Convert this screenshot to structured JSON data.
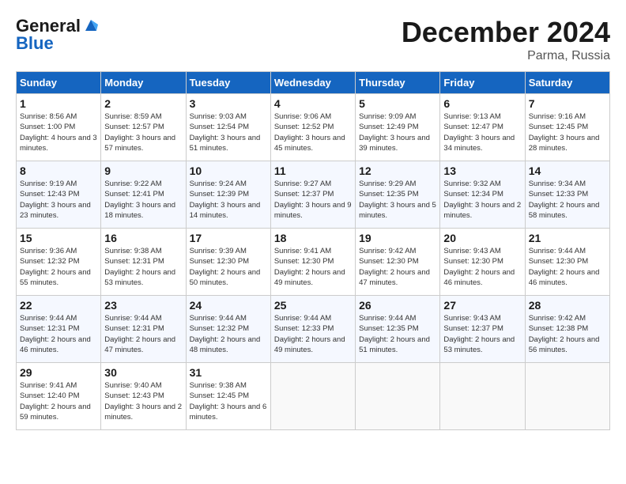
{
  "header": {
    "logo_general": "General",
    "logo_blue": "Blue",
    "title": "December 2024",
    "location": "Parma, Russia"
  },
  "days_of_week": [
    "Sunday",
    "Monday",
    "Tuesday",
    "Wednesday",
    "Thursday",
    "Friday",
    "Saturday"
  ],
  "weeks": [
    [
      {
        "day": "1",
        "sunrise": "Sunrise: 8:56 AM",
        "sunset": "Sunset: 1:00 PM",
        "daylight": "Daylight: 4 hours and 3 minutes."
      },
      {
        "day": "2",
        "sunrise": "Sunrise: 8:59 AM",
        "sunset": "Sunset: 12:57 PM",
        "daylight": "Daylight: 3 hours and 57 minutes."
      },
      {
        "day": "3",
        "sunrise": "Sunrise: 9:03 AM",
        "sunset": "Sunset: 12:54 PM",
        "daylight": "Daylight: 3 hours and 51 minutes."
      },
      {
        "day": "4",
        "sunrise": "Sunrise: 9:06 AM",
        "sunset": "Sunset: 12:52 PM",
        "daylight": "Daylight: 3 hours and 45 minutes."
      },
      {
        "day": "5",
        "sunrise": "Sunrise: 9:09 AM",
        "sunset": "Sunset: 12:49 PM",
        "daylight": "Daylight: 3 hours and 39 minutes."
      },
      {
        "day": "6",
        "sunrise": "Sunrise: 9:13 AM",
        "sunset": "Sunset: 12:47 PM",
        "daylight": "Daylight: 3 hours and 34 minutes."
      },
      {
        "day": "7",
        "sunrise": "Sunrise: 9:16 AM",
        "sunset": "Sunset: 12:45 PM",
        "daylight": "Daylight: 3 hours and 28 minutes."
      }
    ],
    [
      {
        "day": "8",
        "sunrise": "Sunrise: 9:19 AM",
        "sunset": "Sunset: 12:43 PM",
        "daylight": "Daylight: 3 hours and 23 minutes."
      },
      {
        "day": "9",
        "sunrise": "Sunrise: 9:22 AM",
        "sunset": "Sunset: 12:41 PM",
        "daylight": "Daylight: 3 hours and 18 minutes."
      },
      {
        "day": "10",
        "sunrise": "Sunrise: 9:24 AM",
        "sunset": "Sunset: 12:39 PM",
        "daylight": "Daylight: 3 hours and 14 minutes."
      },
      {
        "day": "11",
        "sunrise": "Sunrise: 9:27 AM",
        "sunset": "Sunset: 12:37 PM",
        "daylight": "Daylight: 3 hours and 9 minutes."
      },
      {
        "day": "12",
        "sunrise": "Sunrise: 9:29 AM",
        "sunset": "Sunset: 12:35 PM",
        "daylight": "Daylight: 3 hours and 5 minutes."
      },
      {
        "day": "13",
        "sunrise": "Sunrise: 9:32 AM",
        "sunset": "Sunset: 12:34 PM",
        "daylight": "Daylight: 3 hours and 2 minutes."
      },
      {
        "day": "14",
        "sunrise": "Sunrise: 9:34 AM",
        "sunset": "Sunset: 12:33 PM",
        "daylight": "Daylight: 2 hours and 58 minutes."
      }
    ],
    [
      {
        "day": "15",
        "sunrise": "Sunrise: 9:36 AM",
        "sunset": "Sunset: 12:32 PM",
        "daylight": "Daylight: 2 hours and 55 minutes."
      },
      {
        "day": "16",
        "sunrise": "Sunrise: 9:38 AM",
        "sunset": "Sunset: 12:31 PM",
        "daylight": "Daylight: 2 hours and 53 minutes."
      },
      {
        "day": "17",
        "sunrise": "Sunrise: 9:39 AM",
        "sunset": "Sunset: 12:30 PM",
        "daylight": "Daylight: 2 hours and 50 minutes."
      },
      {
        "day": "18",
        "sunrise": "Sunrise: 9:41 AM",
        "sunset": "Sunset: 12:30 PM",
        "daylight": "Daylight: 2 hours and 49 minutes."
      },
      {
        "day": "19",
        "sunrise": "Sunrise: 9:42 AM",
        "sunset": "Sunset: 12:30 PM",
        "daylight": "Daylight: 2 hours and 47 minutes."
      },
      {
        "day": "20",
        "sunrise": "Sunrise: 9:43 AM",
        "sunset": "Sunset: 12:30 PM",
        "daylight": "Daylight: 2 hours and 46 minutes."
      },
      {
        "day": "21",
        "sunrise": "Sunrise: 9:44 AM",
        "sunset": "Sunset: 12:30 PM",
        "daylight": "Daylight: 2 hours and 46 minutes."
      }
    ],
    [
      {
        "day": "22",
        "sunrise": "Sunrise: 9:44 AM",
        "sunset": "Sunset: 12:31 PM",
        "daylight": "Daylight: 2 hours and 46 minutes."
      },
      {
        "day": "23",
        "sunrise": "Sunrise: 9:44 AM",
        "sunset": "Sunset: 12:31 PM",
        "daylight": "Daylight: 2 hours and 47 minutes."
      },
      {
        "day": "24",
        "sunrise": "Sunrise: 9:44 AM",
        "sunset": "Sunset: 12:32 PM",
        "daylight": "Daylight: 2 hours and 48 minutes."
      },
      {
        "day": "25",
        "sunrise": "Sunrise: 9:44 AM",
        "sunset": "Sunset: 12:33 PM",
        "daylight": "Daylight: 2 hours and 49 minutes."
      },
      {
        "day": "26",
        "sunrise": "Sunrise: 9:44 AM",
        "sunset": "Sunset: 12:35 PM",
        "daylight": "Daylight: 2 hours and 51 minutes."
      },
      {
        "day": "27",
        "sunrise": "Sunrise: 9:43 AM",
        "sunset": "Sunset: 12:37 PM",
        "daylight": "Daylight: 2 hours and 53 minutes."
      },
      {
        "day": "28",
        "sunrise": "Sunrise: 9:42 AM",
        "sunset": "Sunset: 12:38 PM",
        "daylight": "Daylight: 2 hours and 56 minutes."
      }
    ],
    [
      {
        "day": "29",
        "sunrise": "Sunrise: 9:41 AM",
        "sunset": "Sunset: 12:40 PM",
        "daylight": "Daylight: 2 hours and 59 minutes."
      },
      {
        "day": "30",
        "sunrise": "Sunrise: 9:40 AM",
        "sunset": "Sunset: 12:43 PM",
        "daylight": "Daylight: 3 hours and 2 minutes."
      },
      {
        "day": "31",
        "sunrise": "Sunrise: 9:38 AM",
        "sunset": "Sunset: 12:45 PM",
        "daylight": "Daylight: 3 hours and 6 minutes."
      },
      null,
      null,
      null,
      null
    ]
  ]
}
